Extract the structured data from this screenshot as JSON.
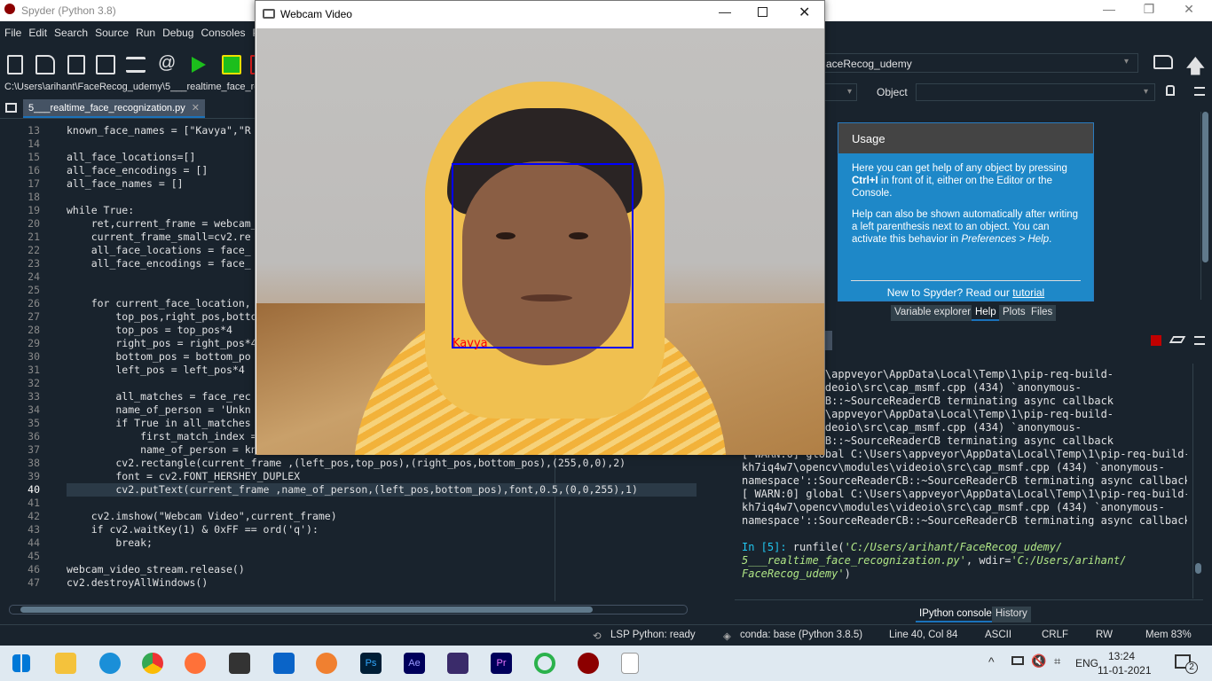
{
  "app": {
    "title": "Spyder (Python 3.8)"
  },
  "menu": [
    "File",
    "Edit",
    "Search",
    "Source",
    "Run",
    "Debug",
    "Consoles",
    "Pr"
  ],
  "path": "C:\\Users\\arihant\\FaceRecog_udemy\\5___realtime_face_re",
  "tab": {
    "label": "5___realtime_face_recognization.py"
  },
  "right_toolbar": {
    "dir": "aceRecog_udemy",
    "object_label": "Object"
  },
  "editor": {
    "lines": [
      {
        "n": "13",
        "t": "known_face_names = [\"Kavya\",\"R"
      },
      {
        "n": "14",
        "t": ""
      },
      {
        "n": "15",
        "t": "all_face_locations=[]"
      },
      {
        "n": "16",
        "t": "all_face_encodings = []"
      },
      {
        "n": "17",
        "t": "all_face_names = []"
      },
      {
        "n": "18",
        "t": ""
      },
      {
        "n": "19",
        "t": "while True:"
      },
      {
        "n": "20",
        "t": "    ret,current_frame = webcam_"
      },
      {
        "n": "21",
        "t": "    current_frame_small=cv2.re"
      },
      {
        "n": "22",
        "t": "    all_face_locations = face_"
      },
      {
        "n": "23",
        "t": "    all_face_encodings = face_"
      },
      {
        "n": "24",
        "t": ""
      },
      {
        "n": "25",
        "t": ""
      },
      {
        "n": "26",
        "t": "    for current_face_location,"
      },
      {
        "n": "27",
        "t": "        top_pos,right_pos,botto"
      },
      {
        "n": "28",
        "t": "        top_pos = top_pos*4"
      },
      {
        "n": "29",
        "t": "        right_pos = right_pos*4"
      },
      {
        "n": "30",
        "t": "        bottom_pos = bottom_po"
      },
      {
        "n": "31",
        "t": "        left_pos = left_pos*4"
      },
      {
        "n": "32",
        "t": ""
      },
      {
        "n": "33",
        "t": "        all_matches = face_rec"
      },
      {
        "n": "34",
        "t": "        name_of_person = 'Unkn"
      },
      {
        "n": "35",
        "t": "        if True in all_matches"
      },
      {
        "n": "36",
        "t": "            first_match_index ="
      },
      {
        "n": "37",
        "t": "            name_of_person = kn"
      },
      {
        "n": "38",
        "t": "        cv2.rectangle(current_frame ,(left_pos,top_pos),(right_pos,bottom_pos),(255,0,0),2)"
      },
      {
        "n": "39",
        "t": "        font = cv2.FONT_HERSHEY_DUPLEX"
      },
      {
        "n": "40",
        "t": "        cv2.putText(current_frame ,name_of_person,(left_pos,bottom_pos),font,0.5,(0,0,255),1)"
      },
      {
        "n": "41",
        "t": ""
      },
      {
        "n": "42",
        "t": "    cv2.imshow(\"Webcam Video\",current_frame)"
      },
      {
        "n": "43",
        "t": "    if cv2.waitKey(1) & 0xFF == ord('q'):"
      },
      {
        "n": "44",
        "t": "        break;"
      },
      {
        "n": "45",
        "t": ""
      },
      {
        "n": "46",
        "t": "webcam_video_stream.release()"
      },
      {
        "n": "47",
        "t": "cv2.destroyAllWindows()"
      }
    ]
  },
  "help": {
    "heading": "Usage",
    "p1a": "Here you can get help of any object by pressing ",
    "p1b": "Ctrl+I",
    "p1c": " in front of it, either on the Editor or the Console.",
    "p2a": "Help can also be shown automatically after writing a left parenthesis next to an object. You can activate this behavior in ",
    "p2b": "Preferences > Help",
    "p2c": ".",
    "foot_a": "New to Spyder? Read our ",
    "foot_b": "tutorial"
  },
  "pane_tabs": [
    "Variable explorer",
    "Help",
    "Plots",
    "Files"
  ],
  "console": {
    "lines": [
      "obal C:\\Users\\appveyor\\AppData\\Local\\Temp\\1\\pip-req-build-",
      "cv\\modules\\videoio\\src\\cap_msmf.cpp (434) `anonymous-",
      "SourceReaderCB::~SourceReaderCB terminating async callback",
      "obal C:\\Users\\appveyor\\AppData\\Local\\Temp\\1\\pip-req-build-",
      "cv\\modules\\videoio\\src\\cap_msmf.cpp (434) `anonymous-",
      "SourceReaderCB::~SourceReaderCB terminating async callback",
      "[ WARN:0] global C:\\Users\\appveyor\\AppData\\Local\\Temp\\1\\pip-req-build-",
      "kh7iq4w7\\opencv\\modules\\videoio\\src\\cap_msmf.cpp (434) `anonymous-",
      "namespace'::SourceReaderCB::~SourceReaderCB terminating async callback",
      "[ WARN:0] global C:\\Users\\appveyor\\AppData\\Local\\Temp\\1\\pip-req-build-",
      "kh7iq4w7\\opencv\\modules\\videoio\\src\\cap_msmf.cpp (434) `anonymous-",
      "namespace'::SourceReaderCB::~SourceReaderCB terminating async callback"
    ],
    "prompt": "In [5]: ",
    "cmd1": "runfile(",
    "arg1": "'C:/Users/arihant/FaceRecog_udemy/",
    "arg2": "5___realtime_face_recognization.py'",
    "wdir": ", wdir=",
    "arg3": "'C:/Users/arihant/",
    "arg4": "FaceRecog_udemy'",
    "close": ")"
  },
  "console_tabs": [
    "IPython console",
    "History"
  ],
  "status": {
    "lsp": "LSP Python: ready",
    "conda": "conda: base (Python 3.8.5)",
    "pos": "Line 40, Col 84",
    "enc": "ASCII",
    "eol": "CRLF",
    "rw": "RW",
    "mem": "Mem 83%"
  },
  "webcam": {
    "title": "Webcam Video",
    "label": "Kavya"
  },
  "taskbar": {
    "time": "13:24",
    "date": "11-01-2021",
    "lang": "ENG",
    "notif": "2"
  },
  "colors": {
    "bg": "#19232d",
    "accent": "#1a72bb",
    "box": "#0000ff",
    "label": "#ff0000"
  }
}
